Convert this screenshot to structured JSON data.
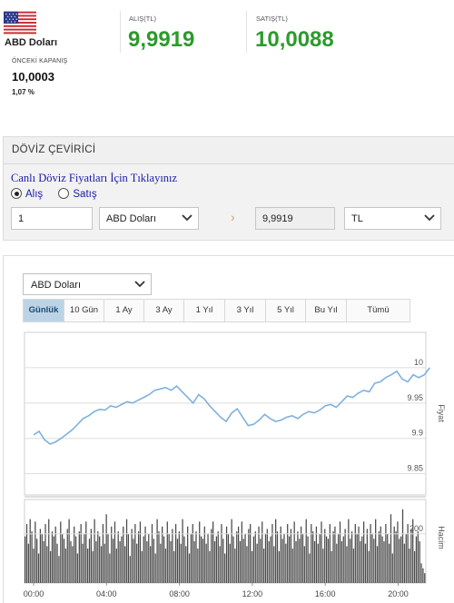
{
  "currency": {
    "name": "ABD Doları",
    "flag_icon": "us-flag-icon"
  },
  "buy": {
    "label": "ALIŞ(TL)",
    "value": "9,9919"
  },
  "sell": {
    "label": "SATIŞ(TL)",
    "value": "10,0088"
  },
  "previous_close": {
    "label": "ÖNCEKİ KAPANIŞ",
    "value": "10,0003"
  },
  "change": "1,07 %",
  "converter": {
    "title": "DÖVİZ ÇEVİRİCİ",
    "live_link": "Canlı Döviz Fiyatları İçin Tıklayınız",
    "radio_buy": "Alış",
    "radio_sell": "Satış",
    "amount": "1",
    "from_currency": "ABD Doları",
    "result": "9,9919",
    "to_currency": "TL",
    "arrow_glyph": "›"
  },
  "chart_panel": {
    "currency_select": "ABD Doları",
    "periods": [
      "Günlük",
      "10 Gün",
      "1 Ay",
      "3 Ay",
      "1 Yıl",
      "3 Yıl",
      "5 Yıl",
      "Bu Yıl",
      "Tümü"
    ],
    "active_period": "Günlük"
  },
  "colors": {
    "accent_green": "#2c9a2c",
    "line": "#7fb0dd",
    "bars": "#4a4a4a",
    "tab_active": "#bcd3e6"
  },
  "chart_data": {
    "type": "line",
    "x_ticks": [
      "00:00",
      "04:00",
      "08:00",
      "12:00",
      "16:00",
      "20:00"
    ],
    "price": {
      "ylabel": "Fiyat",
      "y_ticks": [
        "10",
        "9.95",
        "9.9",
        "9.85"
      ],
      "y_tick_values": [
        10.0,
        9.95,
        9.9,
        9.85
      ],
      "ylim": [
        9.82,
        10.05
      ],
      "x_hours": [
        0,
        0.3,
        0.6,
        0.9,
        1.2,
        1.5,
        1.8,
        2.1,
        2.4,
        2.7,
        3,
        3.3,
        3.6,
        3.9,
        4.2,
        4.5,
        4.8,
        5.1,
        5.4,
        5.7,
        6,
        6.3,
        6.6,
        6.9,
        7.2,
        7.5,
        7.8,
        8.1,
        8.4,
        8.7,
        9,
        9.3,
        9.6,
        9.9,
        10.2,
        10.5,
        10.8,
        11.1,
        11.4,
        11.7,
        12,
        12.3,
        12.6,
        12.9,
        13.2,
        13.5,
        13.8,
        14.1,
        14.4,
        14.7,
        15,
        15.3,
        15.6,
        15.9,
        16.2,
        16.5,
        16.8,
        17.1,
        17.4,
        17.7,
        18,
        18.3,
        18.6,
        18.9,
        19.2,
        19.5,
        19.8,
        20.1,
        20.4,
        20.7,
        21,
        21.3,
        21.6
      ],
      "values": [
        9.905,
        9.91,
        9.898,
        9.892,
        9.895,
        9.9,
        9.906,
        9.912,
        9.92,
        9.928,
        9.932,
        9.938,
        9.941,
        9.94,
        9.946,
        9.944,
        9.948,
        9.952,
        9.95,
        9.954,
        9.958,
        9.962,
        9.968,
        9.97,
        9.972,
        9.968,
        9.974,
        9.966,
        9.958,
        9.95,
        9.962,
        9.956,
        9.946,
        9.938,
        9.93,
        9.924,
        9.936,
        9.942,
        9.93,
        9.918,
        9.92,
        9.926,
        9.934,
        9.928,
        9.924,
        9.926,
        9.93,
        9.932,
        9.928,
        9.934,
        9.938,
        9.936,
        9.94,
        9.946,
        9.948,
        9.944,
        9.952,
        9.96,
        9.958,
        9.964,
        9.968,
        9.966,
        9.978,
        9.98,
        9.986,
        9.99,
        9.995,
        9.984,
        9.98,
        9.99,
        9.986,
        9.99,
        10.0
      ]
    },
    "volume": {
      "ylabel": "Hacim",
      "y_ticks": [
        "200"
      ],
      "y_tick_values": [
        200
      ],
      "ylim": [
        0,
        340
      ],
      "bars_per_hour": 11,
      "values": [
        190,
        240,
        160,
        260,
        210,
        140,
        250,
        180,
        120,
        220,
        200,
        170,
        240,
        150,
        260,
        130,
        210,
        190,
        230,
        160,
        110,
        250,
        200,
        180,
        140,
        220,
        260,
        170,
        150,
        230,
        190,
        120,
        210,
        240,
        160,
        200,
        250,
        140,
        180,
        220,
        130,
        260,
        170,
        210,
        190,
        150,
        240,
        160,
        280,
        200,
        120,
        230,
        180,
        250,
        140,
        210,
        170,
        190,
        230,
        150,
        260,
        200,
        110,
        220,
        180,
        240,
        160,
        210,
        250,
        130,
        190,
        230,
        170,
        200,
        150,
        240,
        180,
        120,
        260,
        210,
        160,
        230,
        190,
        140,
        250,
        200,
        170,
        220,
        130,
        240,
        180,
        210,
        160,
        260,
        190,
        150,
        230,
        120,
        200,
        240,
        170,
        210,
        140,
        250,
        190,
        180,
        230,
        160,
        200,
        130,
        220,
        250,
        170,
        190,
        210,
        150,
        240,
        180,
        120,
        230,
        200,
        160,
        260,
        190,
        140,
        210,
        230,
        170,
        250,
        180,
        200,
        150,
        220,
        240,
        130,
        190,
        210,
        160,
        230,
        180,
        250,
        140,
        200,
        220,
        170,
        190,
        240,
        150,
        260,
        210,
        130,
        230,
        180,
        200,
        160,
        240,
        190,
        220,
        140,
        250,
        170,
        210,
        180,
        230,
        200,
        150,
        260,
        190,
        120,
        240,
        210,
        170,
        230,
        160,
        200,
        250,
        140,
        220,
        190,
        180,
        240,
        130,
        210,
        230,
        160,
        200,
        250,
        170,
        190,
        220,
        150,
        260,
        180,
        210,
        140,
        240,
        200,
        230,
        170,
        190,
        250,
        160,
        220,
        130,
        240,
        200,
        180,
        260,
        150,
        210,
        230,
        190,
        170,
        240,
        200,
        160,
        280,
        120,
        230,
        210,
        250,
        180,
        190,
        300,
        160,
        200,
        240,
        140,
        220,
        260,
        130,
        190,
        210,
        170,
        80,
        60,
        40
      ]
    }
  }
}
